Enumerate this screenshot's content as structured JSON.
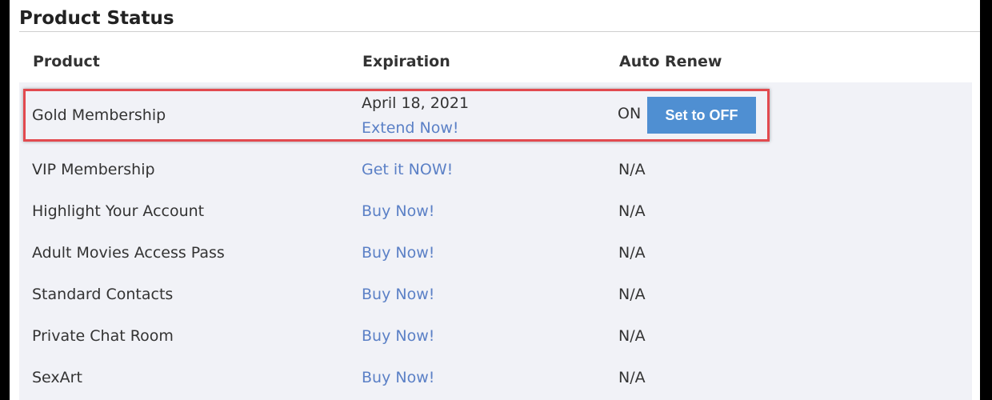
{
  "section": {
    "title": "Product Status"
  },
  "table": {
    "headers": {
      "product": "Product",
      "expiration": "Expiration",
      "auto_renew": "Auto Renew"
    },
    "rows": [
      {
        "product": "Gold Membership",
        "expiration_date": "April 18, 2021",
        "expiration_link": "Extend Now!",
        "auto_renew_status": "ON",
        "auto_renew_button": "Set to OFF"
      },
      {
        "product": "VIP Membership",
        "expiration_link": "Get it NOW!",
        "auto_renew_status": "N/A"
      },
      {
        "product": "Highlight Your Account",
        "expiration_link": "Buy Now!",
        "auto_renew_status": "N/A"
      },
      {
        "product": "Adult Movies Access Pass",
        "expiration_link": "Buy Now!",
        "auto_renew_status": "N/A"
      },
      {
        "product": "Standard Contacts",
        "expiration_link": "Buy Now!",
        "auto_renew_status": "N/A"
      },
      {
        "product": "Private Chat Room",
        "expiration_link": "Buy Now!",
        "auto_renew_status": "N/A"
      },
      {
        "product": "SexArt",
        "expiration_link": "Buy Now!",
        "auto_renew_status": "N/A"
      }
    ]
  },
  "colors": {
    "link": "#5b80c6",
    "button": "#4f8fd2",
    "highlight_border": "#e24a4f",
    "row_background": "#f1f2f7"
  }
}
